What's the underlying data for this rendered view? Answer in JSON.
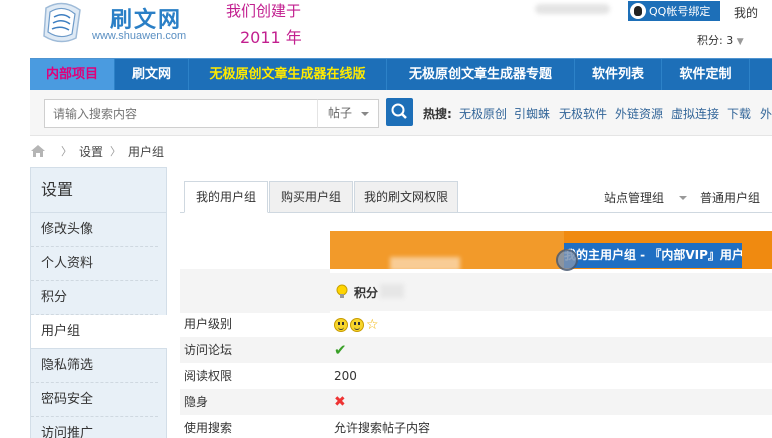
{
  "header": {
    "logo_title": "刷文网",
    "logo_url": "www.shuawen.com",
    "slogan_line1": "我们创建于",
    "slogan_line2": "2011 年",
    "qq_button": "QQ帐号绑定",
    "my_link": "我的",
    "score": "积分: 3"
  },
  "nav": {
    "items": [
      {
        "label": "内部项目"
      },
      {
        "label": "刷文网"
      },
      {
        "label": "无极原创文章生成器在线版"
      },
      {
        "label": "无极原创文章生成器专题"
      },
      {
        "label": "软件列表"
      },
      {
        "label": "软件定制"
      }
    ]
  },
  "search": {
    "placeholder": "请输入搜索内容",
    "type_selected": "帖子",
    "hot_label": "热搜:",
    "hot_links": [
      "无极原创",
      "引蜘蛛",
      "无极软件",
      "外链资源",
      "虚拟连接",
      "下载",
      "外"
    ]
  },
  "breadcrumb": {
    "items": [
      "设置",
      "用户组"
    ]
  },
  "sidebar": {
    "title": "设置",
    "items": [
      "修改头像",
      "个人资料",
      "积分",
      "用户组",
      "隐私筛选",
      "密码安全",
      "访问推广"
    ]
  },
  "tabs": {
    "items": [
      "我的用户组",
      "购买用户组",
      "我的刷文网权限"
    ],
    "right_items": [
      "站点管理组",
      "普通用户组"
    ]
  },
  "group_table": {
    "header_text": "我的主用户组 - 『内部VIP』用户",
    "score_label": "积分",
    "rows": [
      {
        "label": "用户级别",
        "value": ""
      },
      {
        "label": "访问论坛",
        "value": ""
      },
      {
        "label": "阅读权限",
        "value": "200"
      },
      {
        "label": "隐身",
        "value": ""
      },
      {
        "label": "使用搜索",
        "value": "允许搜索帖子内容"
      }
    ]
  },
  "colors": {
    "nav_blue": "#1d6fb8",
    "nav_active_text": "#e0007a",
    "nav_highlight_text": "#ffea00",
    "orange": "#f08a10",
    "vip_blue": "#1f6fc3"
  }
}
